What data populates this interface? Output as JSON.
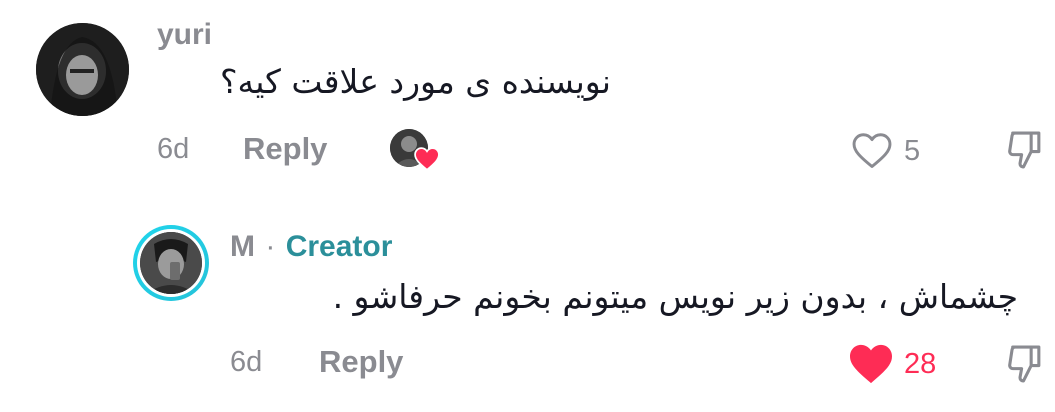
{
  "comment": {
    "username": "yuri",
    "text": "نویسنده ی مورد علاقت کیه؟",
    "time": "6d",
    "reply_label": "Reply",
    "like_count": "5"
  },
  "reply": {
    "username": "M",
    "separator": "·",
    "creator_badge": "Creator",
    "text": "چشماش ، بدون زیر نویس میتونم بخونم حرفاشو .",
    "time": "6d",
    "reply_label": "Reply",
    "like_count": "28"
  },
  "colors": {
    "liked_heart": "#fe2c55",
    "creator_accent": "#2b8f9a",
    "ring": "#20d5ec",
    "muted": "#8a8b91"
  },
  "icons": {
    "like_outline": "heart-outline-icon",
    "like_filled": "heart-filled-icon",
    "dislike": "thumbs-down-icon",
    "creator_liked": "heart-badge-icon"
  }
}
